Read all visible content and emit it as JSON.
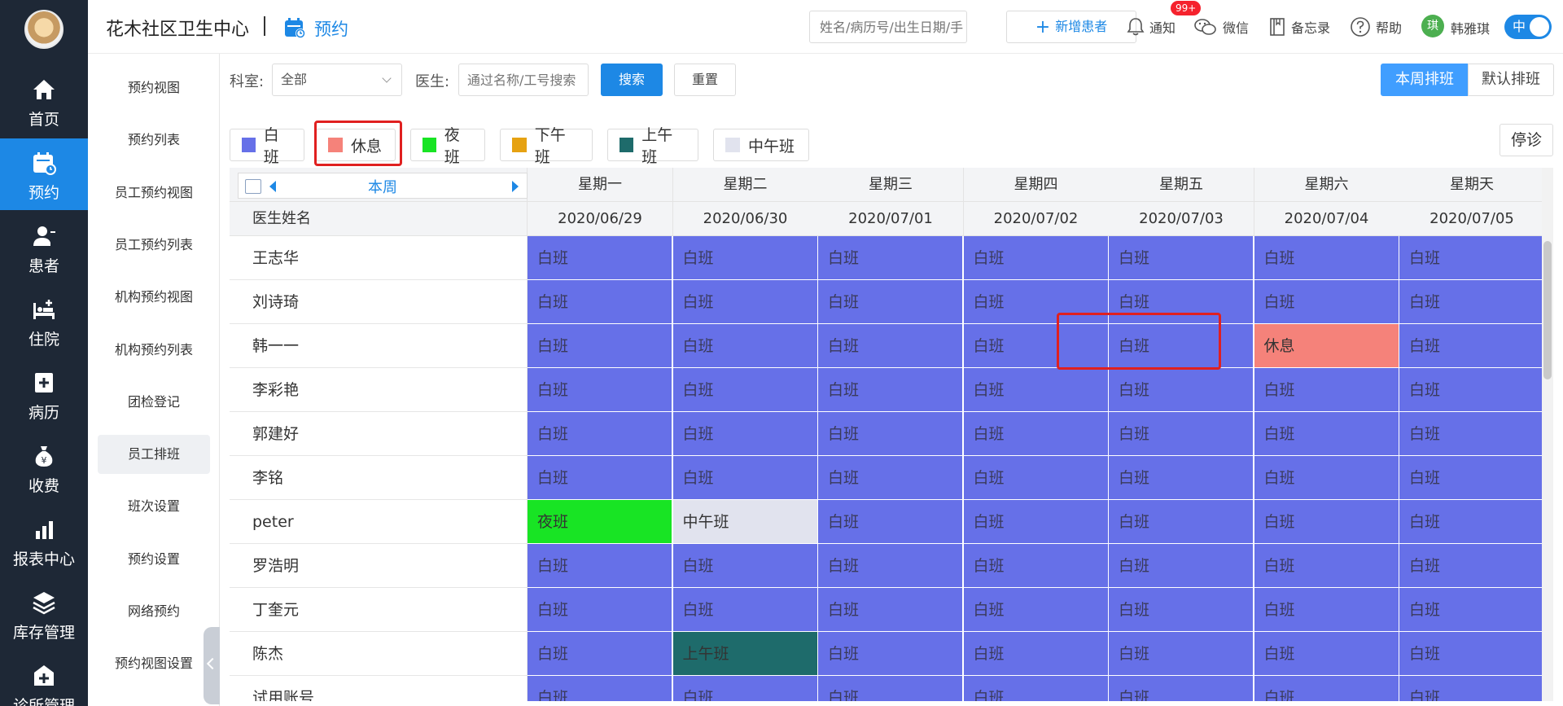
{
  "app": {
    "clinic_name": "花木社区卫生中心",
    "page_title": "预约",
    "search_placeholder": "姓名/病历号/出生日期/手",
    "new_patient": "新增患者",
    "notice": "通知",
    "notice_badge": "99+",
    "wechat": "微信",
    "memo": "备忘录",
    "help": "帮助",
    "user_initial": "琪",
    "user_name": "韩雅琪",
    "lang_toggle": "中"
  },
  "leftnav": [
    {
      "label": "首页",
      "icon": "home-icon"
    },
    {
      "label": "预约",
      "icon": "calendar-icon",
      "active": true
    },
    {
      "label": "患者",
      "icon": "patient-icon"
    },
    {
      "label": "住院",
      "icon": "bed-icon"
    },
    {
      "label": "病历",
      "icon": "medical-record-icon"
    },
    {
      "label": "收费",
      "icon": "money-bag-icon"
    },
    {
      "label": "报表中心",
      "icon": "bar-chart-icon"
    },
    {
      "label": "库存管理",
      "icon": "layers-icon"
    },
    {
      "label": "诊所管理",
      "icon": "clinic-icon"
    }
  ],
  "subnav": [
    "预约视图",
    "预约列表",
    "员工预约视图",
    "员工预约列表",
    "机构预约视图",
    "机构预约列表",
    "团检登记",
    "员工排班",
    "班次设置",
    "预约设置",
    "网络预约",
    "预约视图设置"
  ],
  "subnav_active": "员工排班",
  "filters": {
    "dept_label": "科室:",
    "dept_value": "全部",
    "doctor_label": "医生:",
    "doctor_placeholder": "通过名称/工号搜索",
    "search_btn": "搜索",
    "reset_btn": "重置",
    "week_schedule": "本周排班",
    "default_schedule": "默认排班"
  },
  "legend": [
    {
      "label": "白班",
      "color": "#6670e8"
    },
    {
      "label": "休息",
      "color": "#f5827a"
    },
    {
      "label": "夜班",
      "color": "#18e424"
    },
    {
      "label": "下午班",
      "color": "#e6a212"
    },
    {
      "label": "上午班",
      "color": "#1e6b6b"
    },
    {
      "label": "中午班",
      "color": "#e1e3ee"
    }
  ],
  "stop_btn": "停诊",
  "grid": {
    "week_label": "本周",
    "name_header": "医生姓名",
    "days": [
      {
        "weekday": "星期一",
        "date": "2020/06/29"
      },
      {
        "weekday": "星期二",
        "date": "2020/06/30"
      },
      {
        "weekday": "星期三",
        "date": "2020/07/01"
      },
      {
        "weekday": "星期四",
        "date": "2020/07/02"
      },
      {
        "weekday": "星期五",
        "date": "2020/07/03"
      },
      {
        "weekday": "星期六",
        "date": "2020/07/04"
      },
      {
        "weekday": "星期天",
        "date": "2020/07/05"
      }
    ],
    "rows": [
      {
        "name": "王志华",
        "shifts": [
          "白班",
          "白班",
          "白班",
          "白班",
          "白班",
          "白班",
          "白班"
        ]
      },
      {
        "name": "刘诗琦",
        "shifts": [
          "白班",
          "白班",
          "白班",
          "白班",
          "白班",
          "白班",
          "白班"
        ]
      },
      {
        "name": "韩一一",
        "shifts": [
          "白班",
          "白班",
          "白班",
          "白班",
          "白班",
          "休息",
          "白班"
        ]
      },
      {
        "name": "李彩艳",
        "shifts": [
          "白班",
          "白班",
          "白班",
          "白班",
          "白班",
          "白班",
          "白班"
        ]
      },
      {
        "name": "郭建好",
        "shifts": [
          "白班",
          "白班",
          "白班",
          "白班",
          "白班",
          "白班",
          "白班"
        ]
      },
      {
        "name": "李铭",
        "shifts": [
          "白班",
          "白班",
          "白班",
          "白班",
          "白班",
          "白班",
          "白班"
        ]
      },
      {
        "name": "peter",
        "shifts": [
          "夜班",
          "中午班",
          "白班",
          "白班",
          "白班",
          "白班",
          "白班"
        ]
      },
      {
        "name": "罗浩明",
        "shifts": [
          "白班",
          "白班",
          "白班",
          "白班",
          "白班",
          "白班",
          "白班"
        ]
      },
      {
        "name": "丁奎元",
        "shifts": [
          "白班",
          "白班",
          "白班",
          "白班",
          "白班",
          "白班",
          "白班"
        ]
      },
      {
        "name": "陈杰",
        "shifts": [
          "白班",
          "上午班",
          "白班",
          "白班",
          "白班",
          "白班",
          "白班"
        ]
      },
      {
        "name": "试用账号",
        "shifts": [
          "白班",
          "白班",
          "白班",
          "白班",
          "白班",
          "白班",
          "白班"
        ]
      }
    ]
  }
}
